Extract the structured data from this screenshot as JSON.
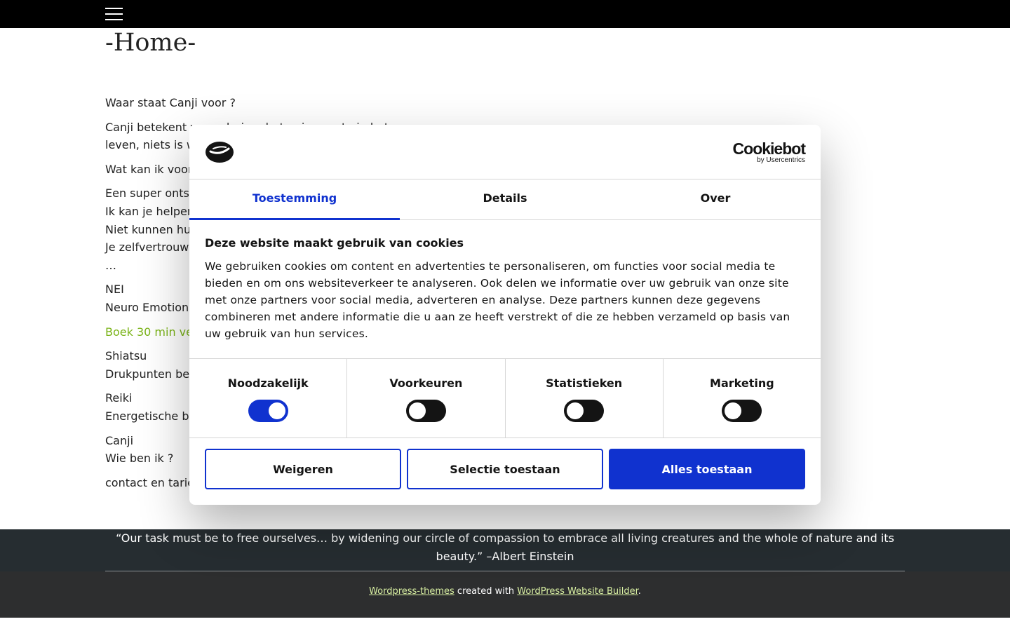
{
  "page": {
    "title": "-Home-",
    "paragraphs": [
      "Waar staat Canji voor ?",
      "Canji betekent verandering, het enige vaste in het leven, niets is weer dezelfde",
      "Wat kan ik voor",
      "Een super ontsp",
      "Ik kan je helpen",
      "Niet kunnen hu",
      "Je zelfvertrouw",
      "…",
      "NEI",
      "Neuro Emotion",
      "Boek 30 min ve",
      "Shiatsu",
      "Drukpunten be",
      "Reiki",
      "Energetische b",
      "Canji",
      "Wie ben ik ?",
      "contact en tarieven"
    ]
  },
  "quote": {
    "text": "“Our task must be to free ourselves… by widening our circle of compassion to embrace all living creatures and the whole of nature and its beauty.” –Albert Einstein"
  },
  "footer": {
    "link1": "Wordpress-themes",
    "middle": " created with ",
    "link2": "WordPress Website Builder",
    "end": "."
  },
  "cookie_dialog": {
    "brand": "Cookiebot",
    "brand_sub": "by Usercentrics",
    "tabs": [
      "Toestemming",
      "Details",
      "Over"
    ],
    "heading": "Deze website maakt gebruik van cookies",
    "body": "We gebruiken cookies om content en advertenties te personaliseren, om functies voor social media te bieden en om ons websiteverkeer te analyseren. Ook delen we informatie over uw gebruik van onze site met onze partners voor social media, adverteren en analyse. Deze partners kunnen deze gegevens combineren met andere informatie die u aan ze heeft verstrekt of die ze hebben verzameld op basis van uw gebruik van hun services.",
    "toggles": [
      {
        "label": "Noodzakelijk",
        "on": true
      },
      {
        "label": "Voorkeuren",
        "on": false
      },
      {
        "label": "Statistieken",
        "on": false
      },
      {
        "label": "Marketing",
        "on": false
      }
    ],
    "buttons": {
      "reject": "Weigeren",
      "selection": "Selectie toestaan",
      "accept_all": "Alles toestaan"
    },
    "accent_color": "#1032cf"
  }
}
